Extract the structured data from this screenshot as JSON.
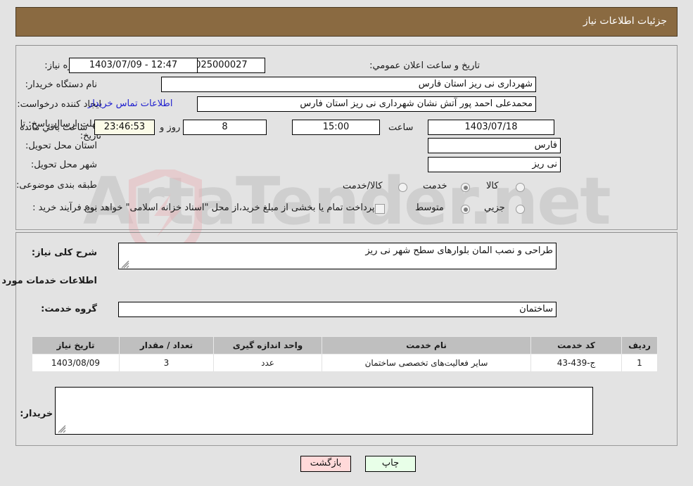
{
  "header": {
    "title": "جزئیات اطلاعات نیاز",
    "bar_color": "#8a6a41"
  },
  "form": {
    "need_number": {
      "label": "شماره نیاز:",
      "value": "1103005025000027"
    },
    "announce_datetime": {
      "label": "تاریخ و ساعت اعلان عمومي:",
      "value": "12:47 - 1403/07/09"
    },
    "buyer_org": {
      "label": "نام دستگاه خریدار:",
      "value": "شهرداری نی ریز استان فارس"
    },
    "creator": {
      "label": "ایجاد کننده درخواست:",
      "value": "محمدعلی احمد پور آتش نشان شهرداری نی ریز استان فارس"
    },
    "buyer_contact_link": "اطلاعات تماس خریدار",
    "deadline": {
      "label": "مهلت ارسال پاسخ: تا تاریخ:",
      "date": "1403/07/18",
      "time_label": "ساعت",
      "time": "15:00",
      "days": "8",
      "days_suffix": "روز و",
      "countdown": "23:46:53",
      "countdown_suffix": "ساعت باقي مانده"
    },
    "province": {
      "label": "استان محل تحویل:",
      "value": "فارس"
    },
    "city": {
      "label": "شهر محل تحویل:",
      "value": "نی ریز"
    },
    "category": {
      "label": "طبقه بندی موضوعی:",
      "options": [
        "کالا",
        "خدمت",
        "کالا/خدمت"
      ],
      "selected": "خدمت"
    },
    "process_type": {
      "label": "نوع فرآیند خرید :",
      "options": [
        "جزیي",
        "متوسط"
      ],
      "selected": "متوسط"
    },
    "treasury_note": {
      "text": "پرداخت تمام یا بخشی از مبلغ خرید،از محل \"اسناد خزانه اسلامی\" خواهد بود.",
      "checked": false
    }
  },
  "description": {
    "label": "شرح کلی نیاز:",
    "value": "طراحی و نصب المان بلوارهای سطح شهر نی ریز"
  },
  "services_section": {
    "heading": "اطلاعات خدمات مورد نیاز",
    "group_label": "گروه خدمت:",
    "group_value": "ساختمان"
  },
  "table": {
    "columns": [
      "ردیف",
      "کد خدمت",
      "نام خدمت",
      "واحد اندازه گیری",
      "تعداد / مقدار",
      "تاریخ نیاز"
    ],
    "rows": [
      [
        "1",
        "ج-439-43",
        "سایر فعالیت‌های تخصصی ساختمان",
        "عدد",
        "3",
        "1403/08/09"
      ]
    ]
  },
  "buyer_notes": {
    "label": "توضیحات خریدار:",
    "value": ""
  },
  "buttons": {
    "print": "چاپ",
    "back": "بازگشت"
  },
  "watermark": {
    "text": "ArtaTender.net"
  }
}
